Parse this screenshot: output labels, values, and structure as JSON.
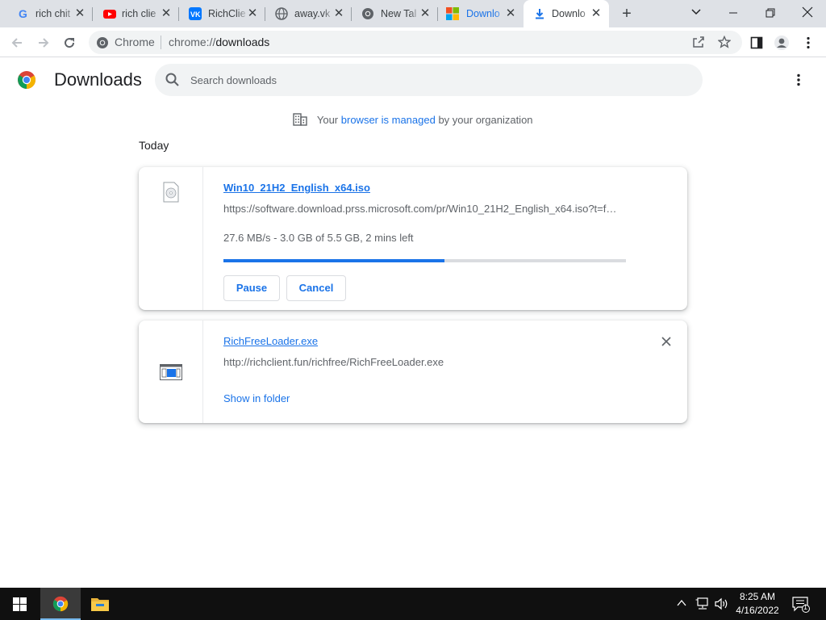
{
  "tabs": [
    {
      "title": "rich chit",
      "icon": "google-icon"
    },
    {
      "title": "rich clie",
      "icon": "youtube-icon"
    },
    {
      "title": "RichClie",
      "icon": "vk-icon"
    },
    {
      "title": "away.vk",
      "icon": "globe-icon"
    },
    {
      "title": "New Tal",
      "icon": "chrome-icon"
    },
    {
      "title": "Downlo",
      "icon": "microsoft-icon"
    },
    {
      "title": "Downlo",
      "icon": "download-icon",
      "active": true
    }
  ],
  "omnibox": {
    "chip": "Chrome",
    "scheme": "chrome://",
    "path": "downloads"
  },
  "page": {
    "title": "Downloads",
    "search_placeholder": "Search downloads",
    "managed_prefix": "Your",
    "managed_link": "browser is managed",
    "managed_suffix": "by your organization",
    "section": "Today"
  },
  "downloads": [
    {
      "filename": "Win10_21H2_English_x64.iso",
      "url": "https://software.download.prss.microsoft.com/pr/Win10_21H2_English_x64.iso?t=f…",
      "status": "27.6 MB/s - 3.0 GB of 5.5 GB, 2 mins left",
      "progress_fraction": 0.55,
      "pause_label": "Pause",
      "cancel_label": "Cancel"
    },
    {
      "filename": "RichFreeLoader.exe",
      "url": "http://richclient.fun/richfree/RichFreeLoader.exe",
      "show_label": "Show in folder"
    }
  ],
  "taskbar": {
    "time": "8:25 AM",
    "date": "4/16/2022",
    "notifications": "1"
  },
  "colors": {
    "accent": "#1a73e8",
    "tabstrip": "#dee1e6",
    "taskbar": "#101010"
  }
}
